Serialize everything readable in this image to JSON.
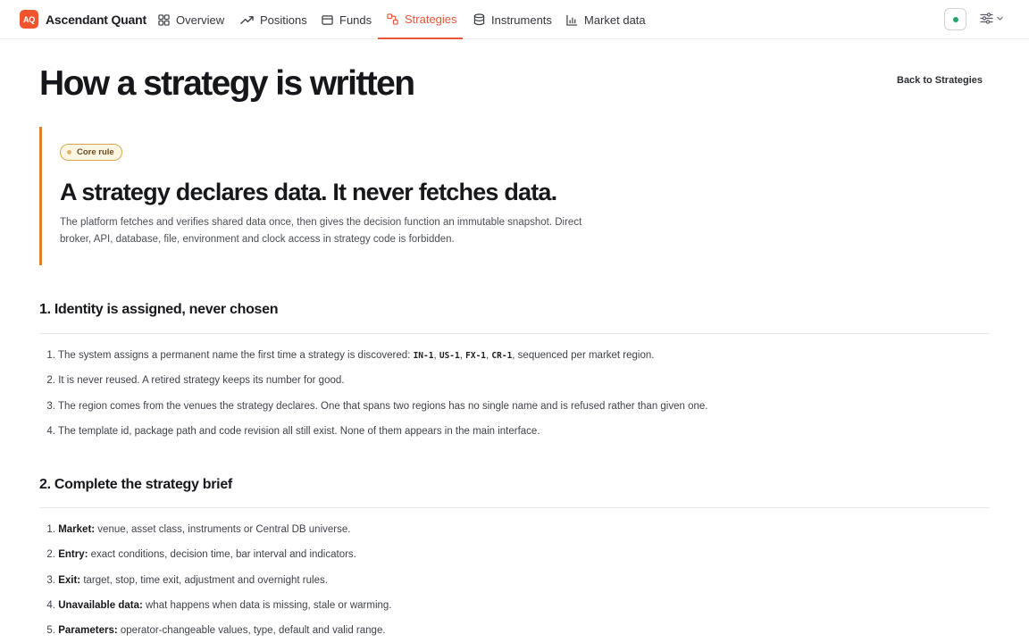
{
  "app": {
    "logo_text": "AQ",
    "name": "Ascendant Quant"
  },
  "nav": [
    {
      "label": "Overview",
      "icon": "grid-icon"
    },
    {
      "label": "Positions",
      "icon": "trending-up-icon"
    },
    {
      "label": "Funds",
      "icon": "wallet-icon"
    },
    {
      "label": "Strategies",
      "icon": "strategy-icon",
      "active": true
    },
    {
      "label": "Instruments",
      "icon": "database-icon"
    },
    {
      "label": "Market data",
      "icon": "bar-chart-icon"
    }
  ],
  "colors": {
    "accent": "#e8563a",
    "brand": "#f0562e",
    "callout_border": "#d9822b",
    "status": "#1fa86a"
  },
  "page": {
    "title": "How a strategy is written",
    "back_link": "Back to Strategies"
  },
  "callout": {
    "badge": "Core rule",
    "title": "A strategy declares data. It never fetches data.",
    "body": "The platform fetches and verifies shared data once, then gives the decision function an immutable snapshot. Direct broker, API, database, file, environment and clock access in strategy code is forbidden."
  },
  "section1": {
    "heading": "1. Identity is assigned, never chosen",
    "items": [
      {
        "num": "1.",
        "text_before": "The system assigns a permanent name the first time a strategy is discovered: ",
        "codes": [
          "IN-1",
          "US-1",
          "FX-1",
          "CR-1"
        ],
        "sep": ", ",
        "text_after": ", sequenced per market region."
      },
      {
        "num": "2.",
        "text": "It is never reused. A retired strategy keeps its number for good."
      },
      {
        "num": "3.",
        "text": "The region comes from the venues the strategy declares. One that spans two regions has no single name and is refused rather than given one."
      },
      {
        "num": "4.",
        "text": "The template id, package path and code revision all still exist. None of them appears in the main interface."
      }
    ]
  },
  "section2": {
    "heading": "2. Complete the strategy brief",
    "items": [
      {
        "num": "1.",
        "label": "Market:",
        "text": " venue, asset class, instruments or Central DB universe."
      },
      {
        "num": "2.",
        "label": "Entry:",
        "text": " exact conditions, decision time, bar interval and indicators."
      },
      {
        "num": "3.",
        "label": "Exit:",
        "text": " target, stop, time exit, adjustment and overnight rules."
      },
      {
        "num": "4.",
        "label": "Unavailable data:",
        "text": " what happens when data is missing, stale or warming."
      },
      {
        "num": "5.",
        "label": "Parameters:",
        "text": " operator-changeable values, type, default and valid range."
      }
    ]
  }
}
